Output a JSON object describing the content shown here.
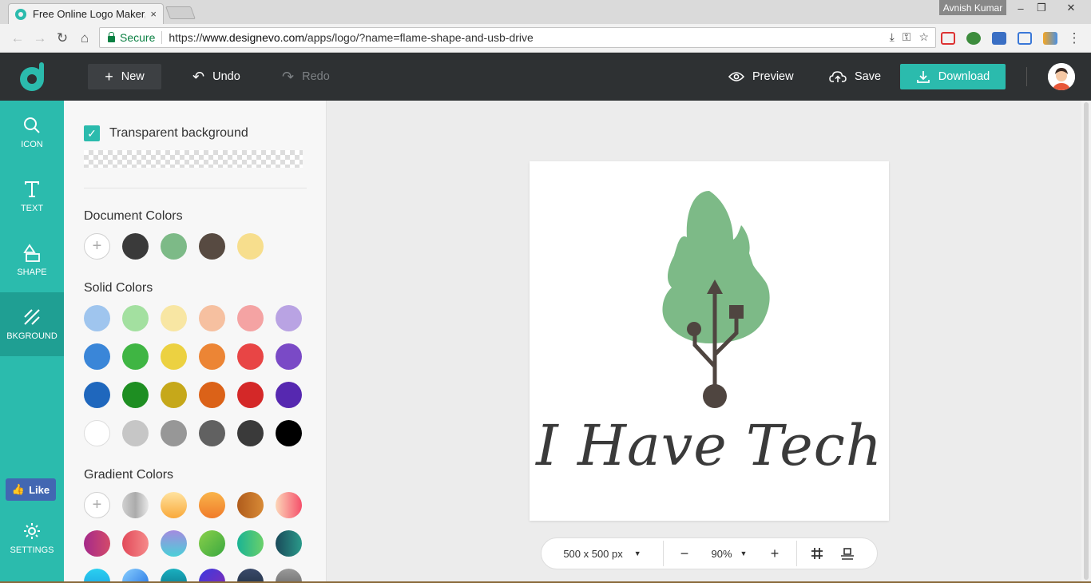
{
  "browser": {
    "tab_title": "Free Online Logo Maker,",
    "tab_close": "×",
    "user_name": "Avnish Kumar",
    "secure_label": "Secure",
    "url_prefix": "https://",
    "url_host": "www.designevo.com",
    "url_path": "/apps/logo/?name=flame-shape-and-usb-drive"
  },
  "header": {
    "new_label": "New",
    "undo_label": "Undo",
    "redo_label": "Redo",
    "preview_label": "Preview",
    "save_label": "Save",
    "download_label": "Download"
  },
  "rail": {
    "items": [
      {
        "label": "ICON",
        "icon": "search-icon"
      },
      {
        "label": "TEXT",
        "icon": "text-icon"
      },
      {
        "label": "SHAPE",
        "icon": "shape-icon"
      },
      {
        "label": "BKGROUND",
        "icon": "background-icon",
        "active": true
      }
    ],
    "like_label": "Like",
    "settings_label": "SETTINGS"
  },
  "panel": {
    "transparent_label": "Transparent background",
    "transparent_checked": true,
    "document_colors_title": "Document Colors",
    "document_colors": [
      "#3a3a3a",
      "#7dba87",
      "#574a41",
      "#f7de8d"
    ],
    "solid_colors_title": "Solid Colors",
    "solid_colors": [
      [
        "#9fc5ee",
        "#a3e0a0",
        "#f8e6a3",
        "#f6c0a0",
        "#f4a3a3",
        "#b9a3e3"
      ],
      [
        "#3a86d8",
        "#3fb543",
        "#ecd141",
        "#ec8535",
        "#e84545",
        "#7a4ac6"
      ],
      [
        "#1f67bd",
        "#1e8e22",
        "#c6a81a",
        "#db6218",
        "#d42828",
        "#5628b0"
      ],
      [
        "#ffffff",
        "#c6c6c6",
        "#979797",
        "#616161",
        "#3a3a3a",
        "#000000"
      ]
    ],
    "gradient_colors_title": "Gradient Colors"
  },
  "canvas": {
    "logo_text": "I Have Tech",
    "size_label": "500 x 500 px",
    "zoom_label": "90%",
    "colors": {
      "flame": "#7dba87",
      "usb": "#4f4540",
      "text": "#3a3a3a"
    }
  },
  "colors": {
    "accent": "#2bbbad",
    "header_bg": "#2e3133"
  }
}
